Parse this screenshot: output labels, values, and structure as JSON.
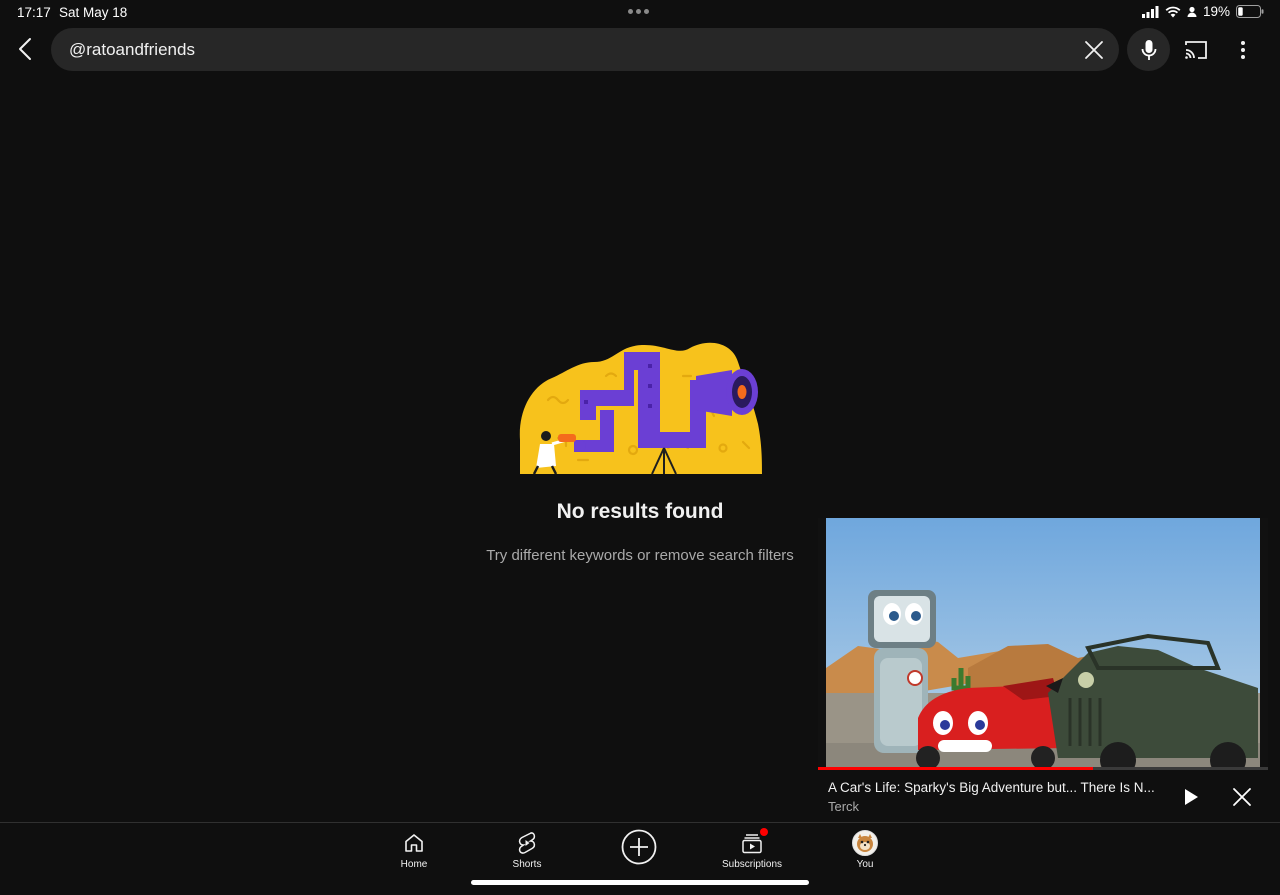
{
  "status_bar": {
    "time": "17:17",
    "date": "Sat May 18",
    "battery": "19%"
  },
  "search": {
    "query": "@ratoandfriends"
  },
  "empty_state": {
    "title": "No results found",
    "subtitle": "Try different keywords or remove search filters"
  },
  "mini_player": {
    "title": "A Car's Life: Sparky's Big Adventure but... There Is N...",
    "channel": "Terck",
    "progress": 0.61
  },
  "bottom_nav": {
    "items": [
      {
        "label": "Home",
        "icon": "home-icon"
      },
      {
        "label": "Shorts",
        "icon": "shorts-icon"
      },
      {
        "label": "Subscriptions",
        "icon": "subscriptions-icon"
      },
      {
        "label": "You",
        "icon": "avatar"
      }
    ]
  },
  "colors": {
    "background": "#0f0f0f",
    "search_field": "#272727",
    "accent_red": "#ff0000",
    "illustration_yellow": "#f7c21c",
    "illustration_purple": "#6b3fd4"
  }
}
